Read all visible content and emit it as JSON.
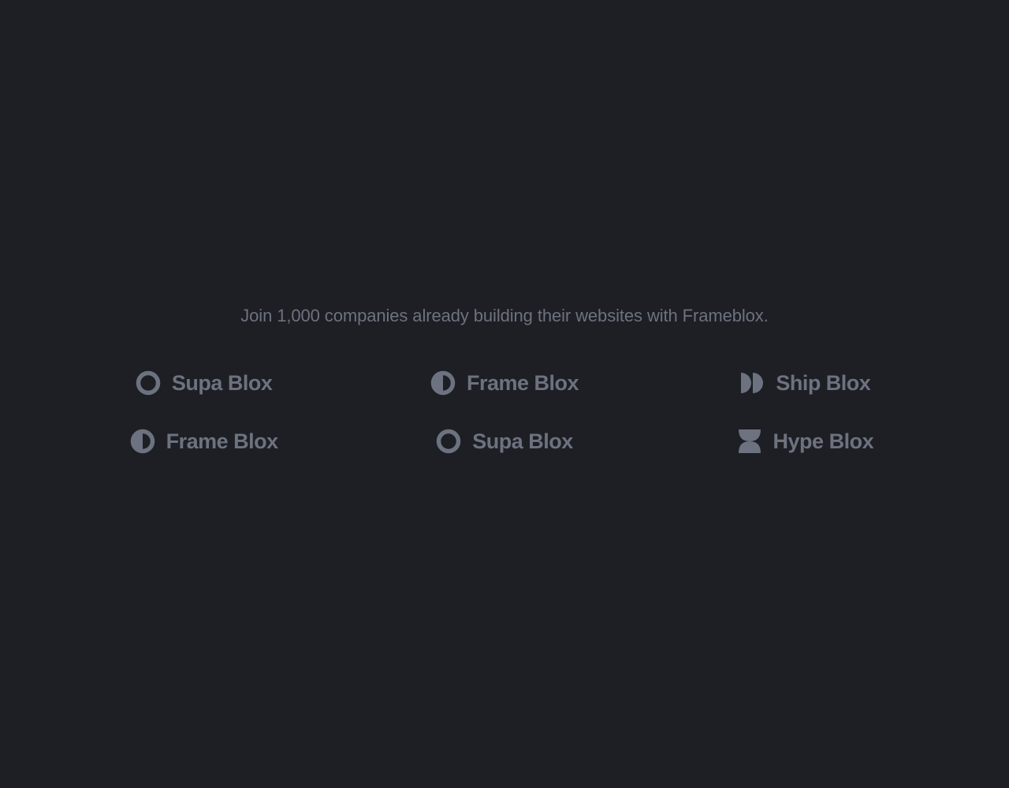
{
  "tagline": "Join 1,000 companies already building their websites with Frameblox.",
  "logos": {
    "r0c0": {
      "name": "Supa Blox",
      "icon": "circle-outline"
    },
    "r0c1": {
      "name": "Frame Blox",
      "icon": "circle-half"
    },
    "r0c2": {
      "name": "Ship Blox",
      "icon": "double-d"
    },
    "r1c0": {
      "name": "Frame Blox",
      "icon": "circle-half"
    },
    "r1c1": {
      "name": "Supa Blox",
      "icon": "circle-outline"
    },
    "r1c2": {
      "name": "Hype Blox",
      "icon": "hourglass"
    }
  },
  "colors": {
    "background": "#1d1f24",
    "muted": "#6d7280"
  }
}
